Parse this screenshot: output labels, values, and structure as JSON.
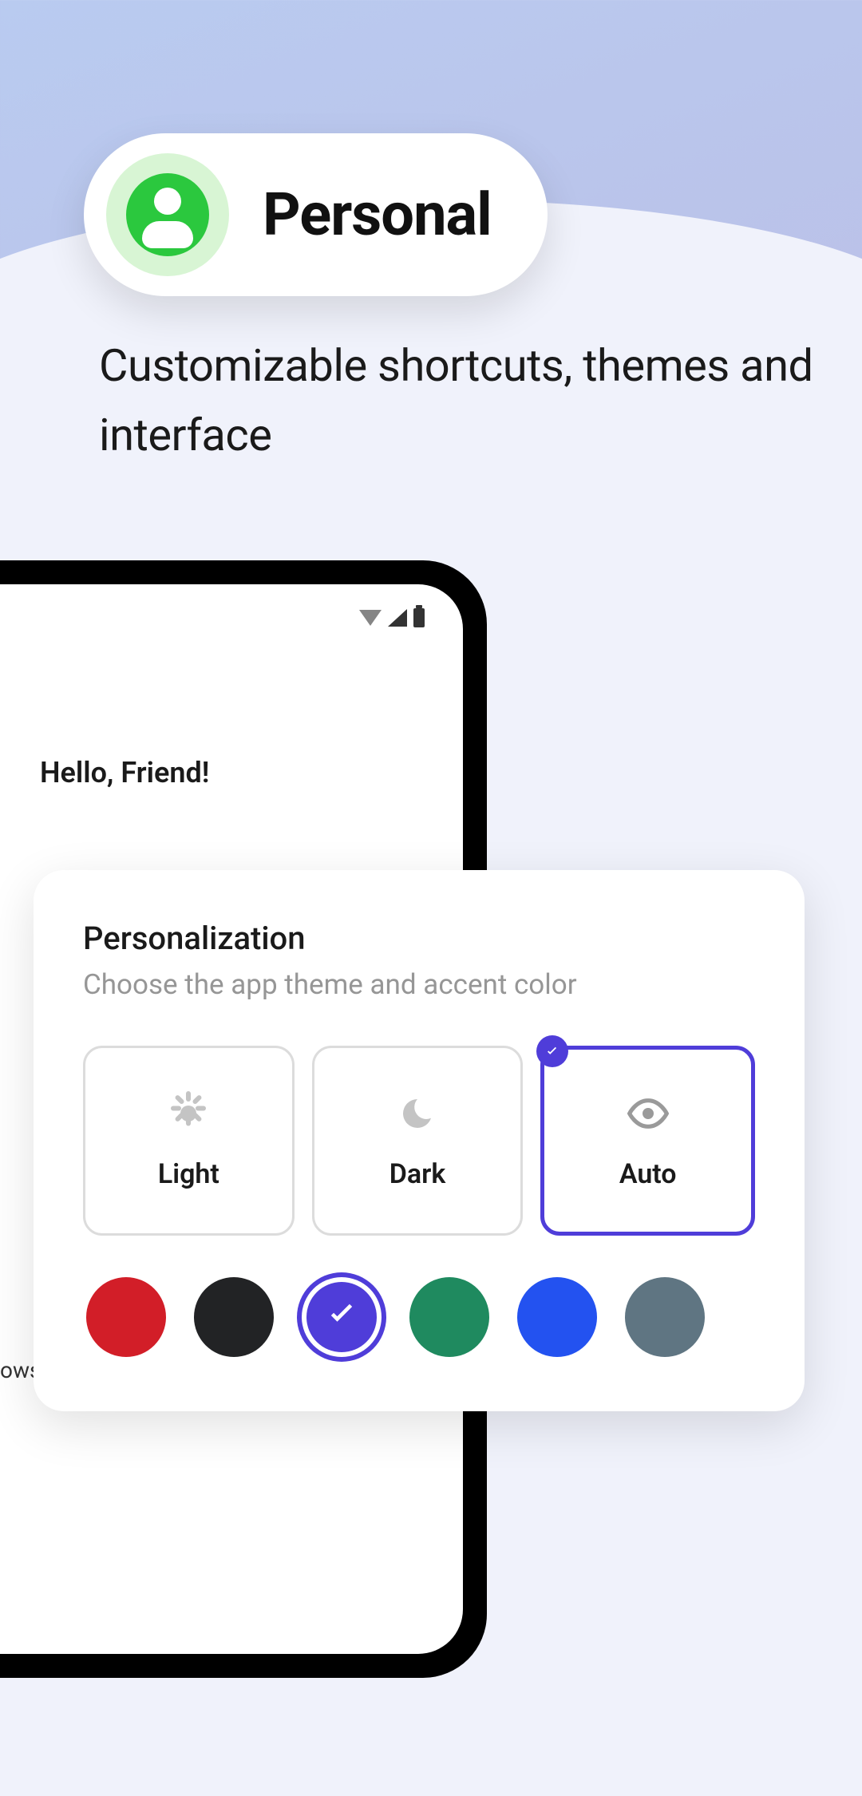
{
  "pill": {
    "label": "Personal"
  },
  "tagline": "Customizable shortcuts, themes and interface",
  "phone": {
    "greeting": "Hello, Friend!"
  },
  "card": {
    "title": "Personalization",
    "subtitle": "Choose the app theme and accent color",
    "themes": [
      {
        "label": "Light",
        "icon": "sun",
        "selected": false
      },
      {
        "label": "Dark",
        "icon": "moon",
        "selected": false
      },
      {
        "label": "Auto",
        "icon": "eye",
        "selected": true
      }
    ],
    "colors": [
      {
        "name": "red",
        "hex": "#d21e28",
        "selected": false
      },
      {
        "name": "black",
        "hex": "#222325",
        "selected": false
      },
      {
        "name": "purple",
        "hex": "#4f3dd9",
        "selected": true
      },
      {
        "name": "green",
        "hex": "#1f8a5f",
        "selected": false
      },
      {
        "name": "blue",
        "hex": "#2352f0",
        "selected": false
      },
      {
        "name": "slate",
        "hex": "#5f7582",
        "selected": false
      }
    ]
  },
  "edge_text": "ows"
}
